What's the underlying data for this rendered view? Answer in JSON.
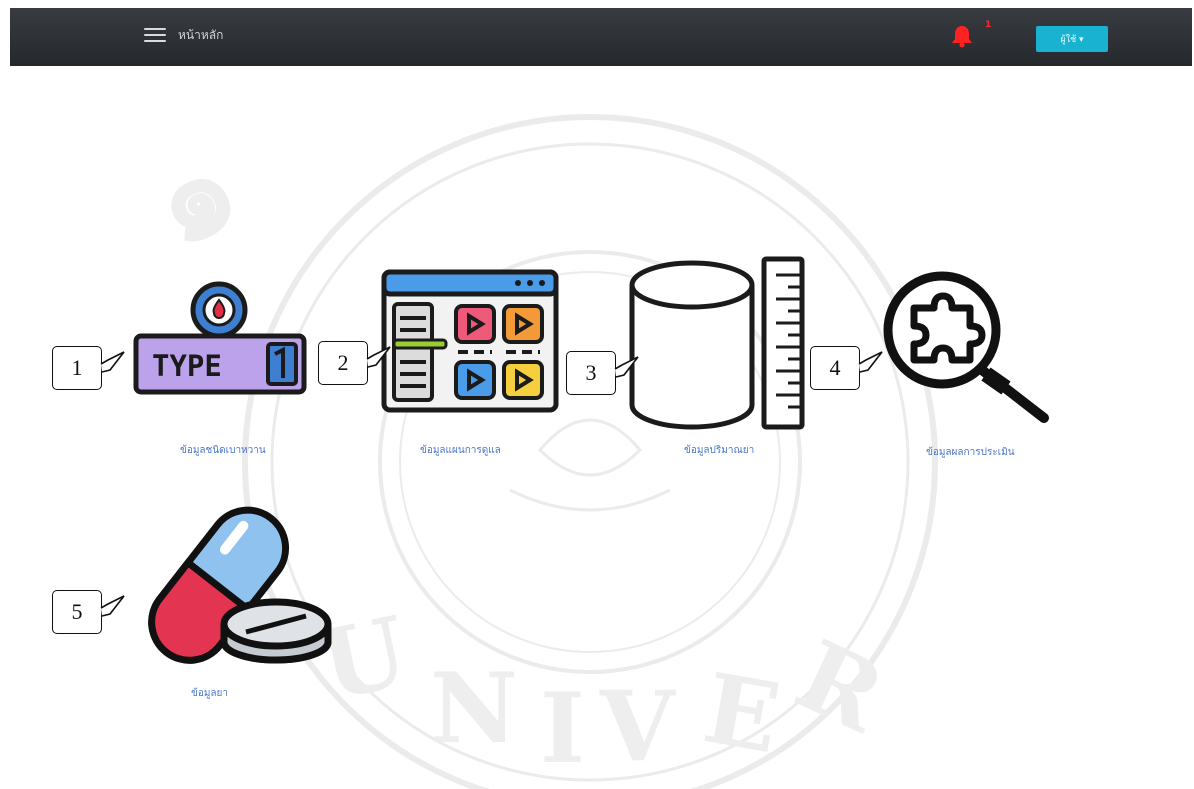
{
  "header": {
    "page_title": "หน้าหลัก",
    "notification_count": "1",
    "user_button_label": "ผู้ใช้ ▾"
  },
  "tiles": [
    {
      "label": "ข้อมูลชนิดเบาหวาน",
      "icon": "type1-diabetes-icon"
    },
    {
      "label": "ข้อมูลแผนการดูแล",
      "icon": "media-dashboard-icon"
    },
    {
      "label": "ข้อมูลปริมาณยา",
      "icon": "cylinder-ruler-icon"
    },
    {
      "label": "ข้อมูลผลการประเมิน",
      "icon": "puzzle-search-icon"
    },
    {
      "label": "ข้อมูลยา",
      "icon": "medicine-pill-icon"
    }
  ],
  "callouts": [
    "1",
    "2",
    "3",
    "4",
    "5"
  ],
  "icon_text": {
    "type_label": "TYPE"
  },
  "colors": {
    "topbar": "#2e3236",
    "accent": "#19b3d1",
    "label": "#4a76c9",
    "badge": "#ff2a2a"
  }
}
